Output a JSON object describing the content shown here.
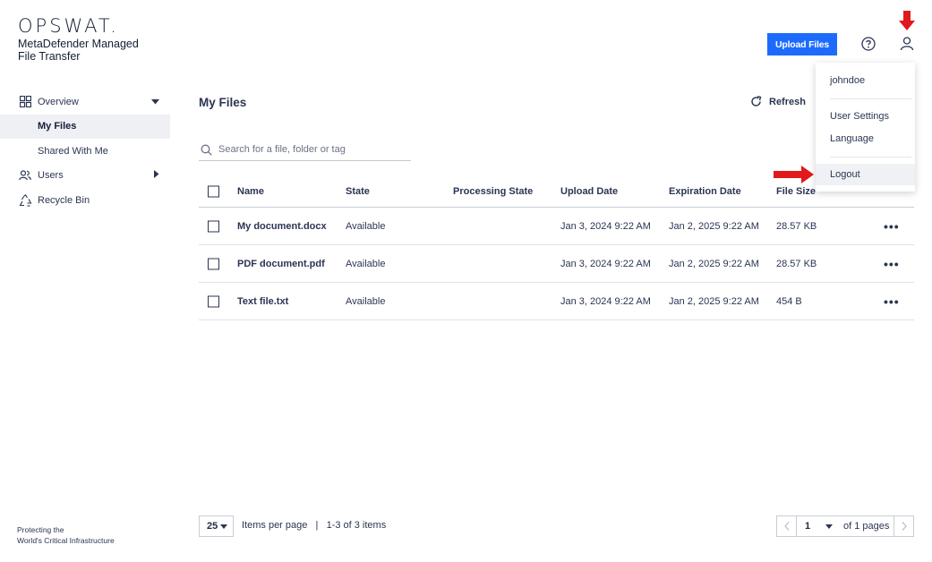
{
  "brand": {
    "logo": "OPSWAT.",
    "product": "MetaDefender Managed File Transfer",
    "tagline_line1": "Protecting the",
    "tagline_line2": "World's Critical Infrastructure"
  },
  "sidebar": {
    "items": [
      {
        "label": "Overview",
        "icon": "grid-icon",
        "caret": "down"
      },
      {
        "label": "My Files",
        "active": true
      },
      {
        "label": "Shared With Me"
      },
      {
        "label": "Users",
        "icon": "users-icon",
        "caret": "right"
      },
      {
        "label": "Recycle Bin",
        "icon": "recycle-icon"
      }
    ]
  },
  "header": {
    "upload_label": "Upload Files",
    "help_icon": "help-icon",
    "user_icon": "user-icon",
    "accent_color": "#1d6bfc"
  },
  "main": {
    "title": "My Files",
    "refresh_label": "Refresh",
    "search_placeholder": "Search for a file, folder or tag",
    "columns": [
      "Name",
      "State",
      "Processing State",
      "Upload Date",
      "Expiration Date",
      "File Size"
    ],
    "rows": [
      {
        "name": "My document.docx",
        "state": "Available",
        "processing": "",
        "upload": "Jan 3, 2024 9:22 AM",
        "expiration": "Jan 2, 2025 9:22 AM",
        "size": "28.57 KB",
        "more": "•••"
      },
      {
        "name": "PDF document.pdf",
        "state": "Available",
        "processing": "",
        "upload": "Jan 3, 2024 9:22 AM",
        "expiration": "Jan 2, 2025 9:22 AM",
        "size": "28.57 KB",
        "more": "•••"
      },
      {
        "name": "Text file.txt",
        "state": "Available",
        "processing": "",
        "upload": "Jan 3, 2024 9:22 AM",
        "expiration": "Jan 2, 2025 9:22 AM",
        "size": "454 B",
        "more": "•••"
      }
    ]
  },
  "pagination": {
    "per_page": "25",
    "per_page_label": "Items per page",
    "separator": "|",
    "range": "1-3 of 3 items",
    "page": "1",
    "of_pages": "of 1 pages"
  },
  "user_menu": {
    "username": "johndoe",
    "items": [
      "User Settings",
      "Language"
    ],
    "logout": "Logout"
  },
  "annotations": {
    "arrow_color": "#e0191c"
  }
}
